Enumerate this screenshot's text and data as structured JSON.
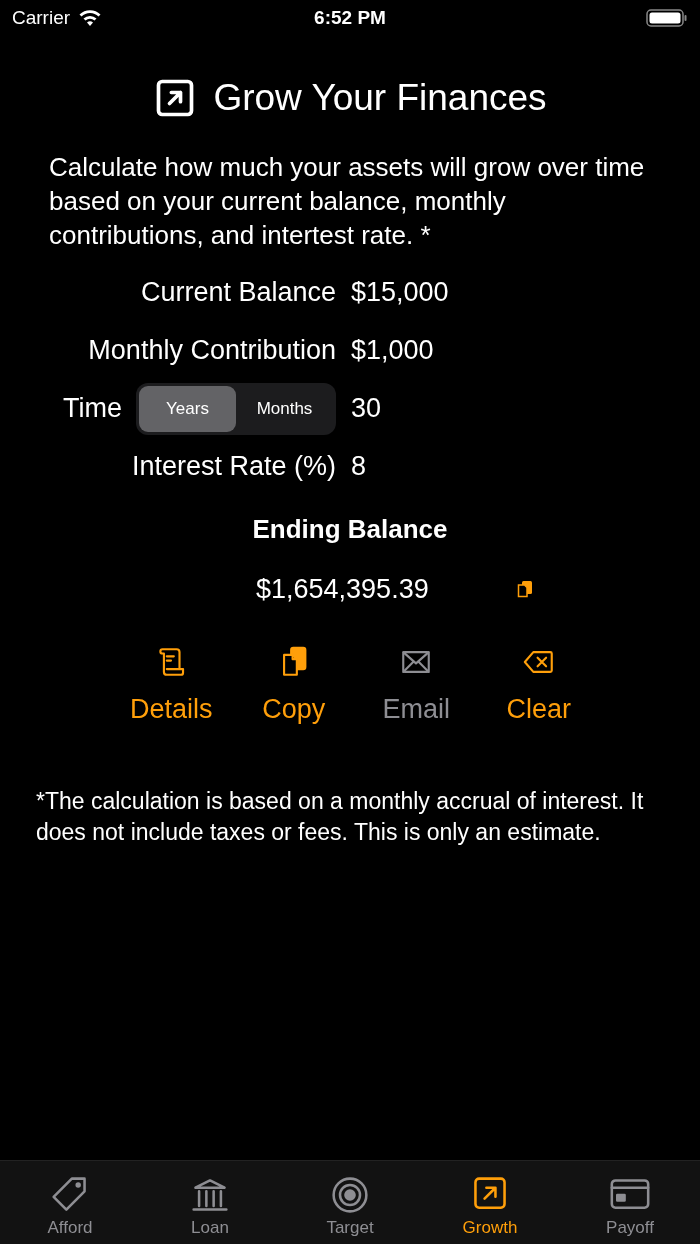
{
  "status_bar": {
    "carrier": "Carrier",
    "time": "6:52 PM"
  },
  "title": "Grow Your Finances",
  "description": "Calculate how much your assets will grow over time based on your current balance, monthly contributions, and intertest rate. *",
  "fields": [
    {
      "kind": "value",
      "label": "Current Balance",
      "value": "$15,000"
    },
    {
      "kind": "value",
      "label": "Monthly Contribution",
      "value": "$1,000"
    },
    {
      "kind": "segmented",
      "label": "Time",
      "options": [
        {
          "label": "Years",
          "selected": true
        },
        {
          "label": "Months",
          "selected": false
        }
      ],
      "value": "30"
    },
    {
      "kind": "value",
      "label": "Interest Rate (%)",
      "value": "8"
    }
  ],
  "result": {
    "label": "Ending Balance",
    "value": "$1,654,395.39"
  },
  "actions": [
    {
      "label": "Details",
      "disabled": false
    },
    {
      "label": "Copy",
      "disabled": false
    },
    {
      "label": "Email",
      "disabled": true
    },
    {
      "label": "Clear",
      "disabled": false
    }
  ],
  "footnote": "*The calculation is based on a monthly accrual of interest.  It does not include taxes or fees.  This is only an estimate.",
  "tabs": [
    {
      "label": "Afford",
      "selected": false
    },
    {
      "label": "Loan",
      "selected": false
    },
    {
      "label": "Target",
      "selected": false
    },
    {
      "label": "Growth",
      "selected": true
    },
    {
      "label": "Payoff",
      "selected": false
    }
  ]
}
